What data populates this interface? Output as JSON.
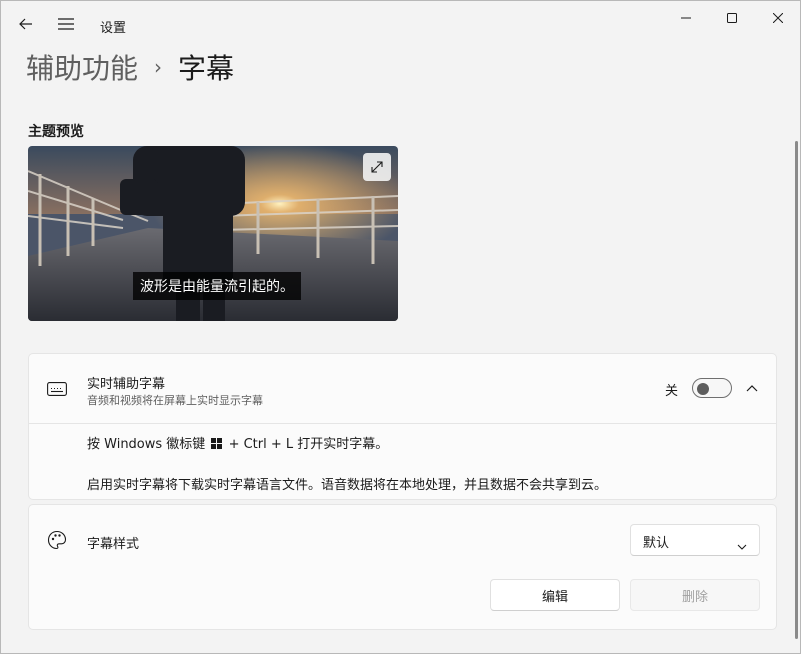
{
  "titlebar": {
    "title": "设置",
    "back_icon": "back-arrow-icon",
    "menu_icon": "hamburger-menu-icon",
    "minimize_icon": "minimize-icon",
    "maximize_icon": "maximize-icon",
    "close_icon": "close-icon"
  },
  "header": {
    "parent": "辅助功能",
    "separator": "›",
    "current": "字幕"
  },
  "preview": {
    "label": "主题预览",
    "caption_text": "波形是由能量流引起的。",
    "expand_icon": "expand-icon"
  },
  "live_captions": {
    "icon": "keyboard-caption-icon",
    "title": "实时辅助字幕",
    "subtitle": "音频和视频将在屏幕上实时显示字幕",
    "toggle_state_label": "关",
    "toggle_on": false,
    "info_line1_prefix": "按 Windows 徽标键",
    "info_line1_suffix": "+ Ctrl + L 打开实时字幕。",
    "info_line2": "启用实时字幕将下载实时字幕语言文件。语音数据将在本地处理，并且数据不会共享到云。"
  },
  "caption_style": {
    "icon": "palette-icon",
    "title": "字幕样式",
    "dropdown_value": "默认",
    "edit_label": "编辑",
    "delete_label": "删除"
  }
}
